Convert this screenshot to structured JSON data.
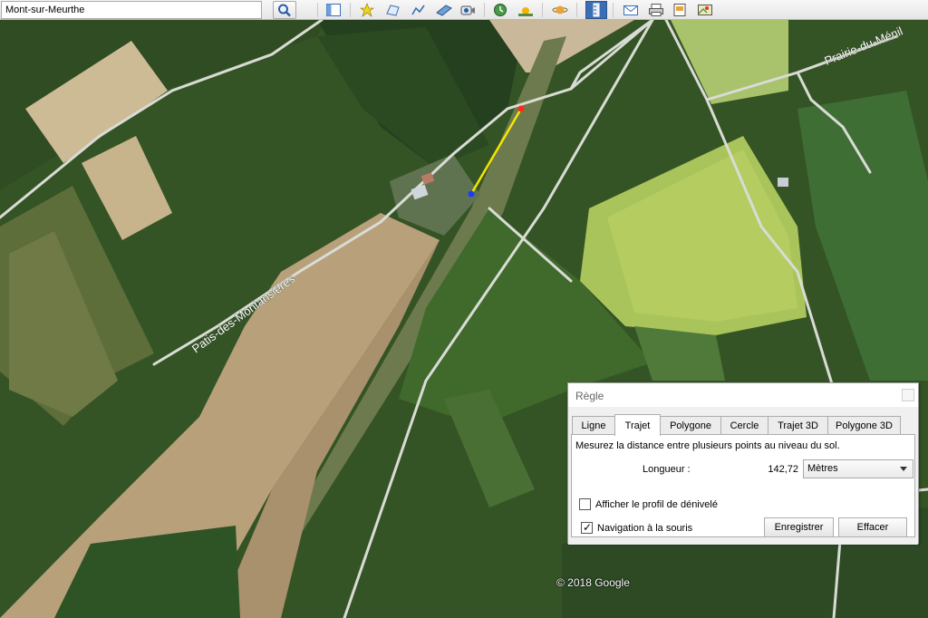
{
  "search": {
    "value": "Mont-sur-Meurthe"
  },
  "toolbar": {
    "icons": [
      "search-icon",
      "sidebar-panel-icon",
      "add-placemark-icon",
      "add-polygon-icon",
      "add-path-icon",
      "add-image-overlay-icon",
      "record-tour-icon",
      "historical-imagery-icon",
      "sunlight-icon",
      "planets-icon",
      "ruler-icon",
      "email-icon",
      "print-icon",
      "save-image-icon",
      "view-in-maps-icon"
    ]
  },
  "map": {
    "road_labels": [
      "Patis-des-Montansières",
      "Prairie-du-Ménil"
    ],
    "copyright": "© 2018 Google",
    "measure_colors": {
      "line": "#f5e600",
      "start": "#1a3cff",
      "end": "#ff2a1a"
    }
  },
  "ruler": {
    "title": "Règle",
    "tabs": [
      "Ligne",
      "Trajet",
      "Polygone",
      "Cercle",
      "Trajet 3D",
      "Polygone 3D"
    ],
    "active_tab": "Trajet",
    "description": "Mesurez la distance entre plusieurs points au niveau du sol.",
    "length_label": "Longueur :",
    "length_value": "142,72",
    "unit": "Mètres",
    "profile_label": "Afficher le profil de dénivelé",
    "profile_checked": false,
    "nav_label": "Navigation à la souris",
    "nav_checked": true,
    "save_label": "Enregistrer",
    "clear_label": "Effacer"
  }
}
